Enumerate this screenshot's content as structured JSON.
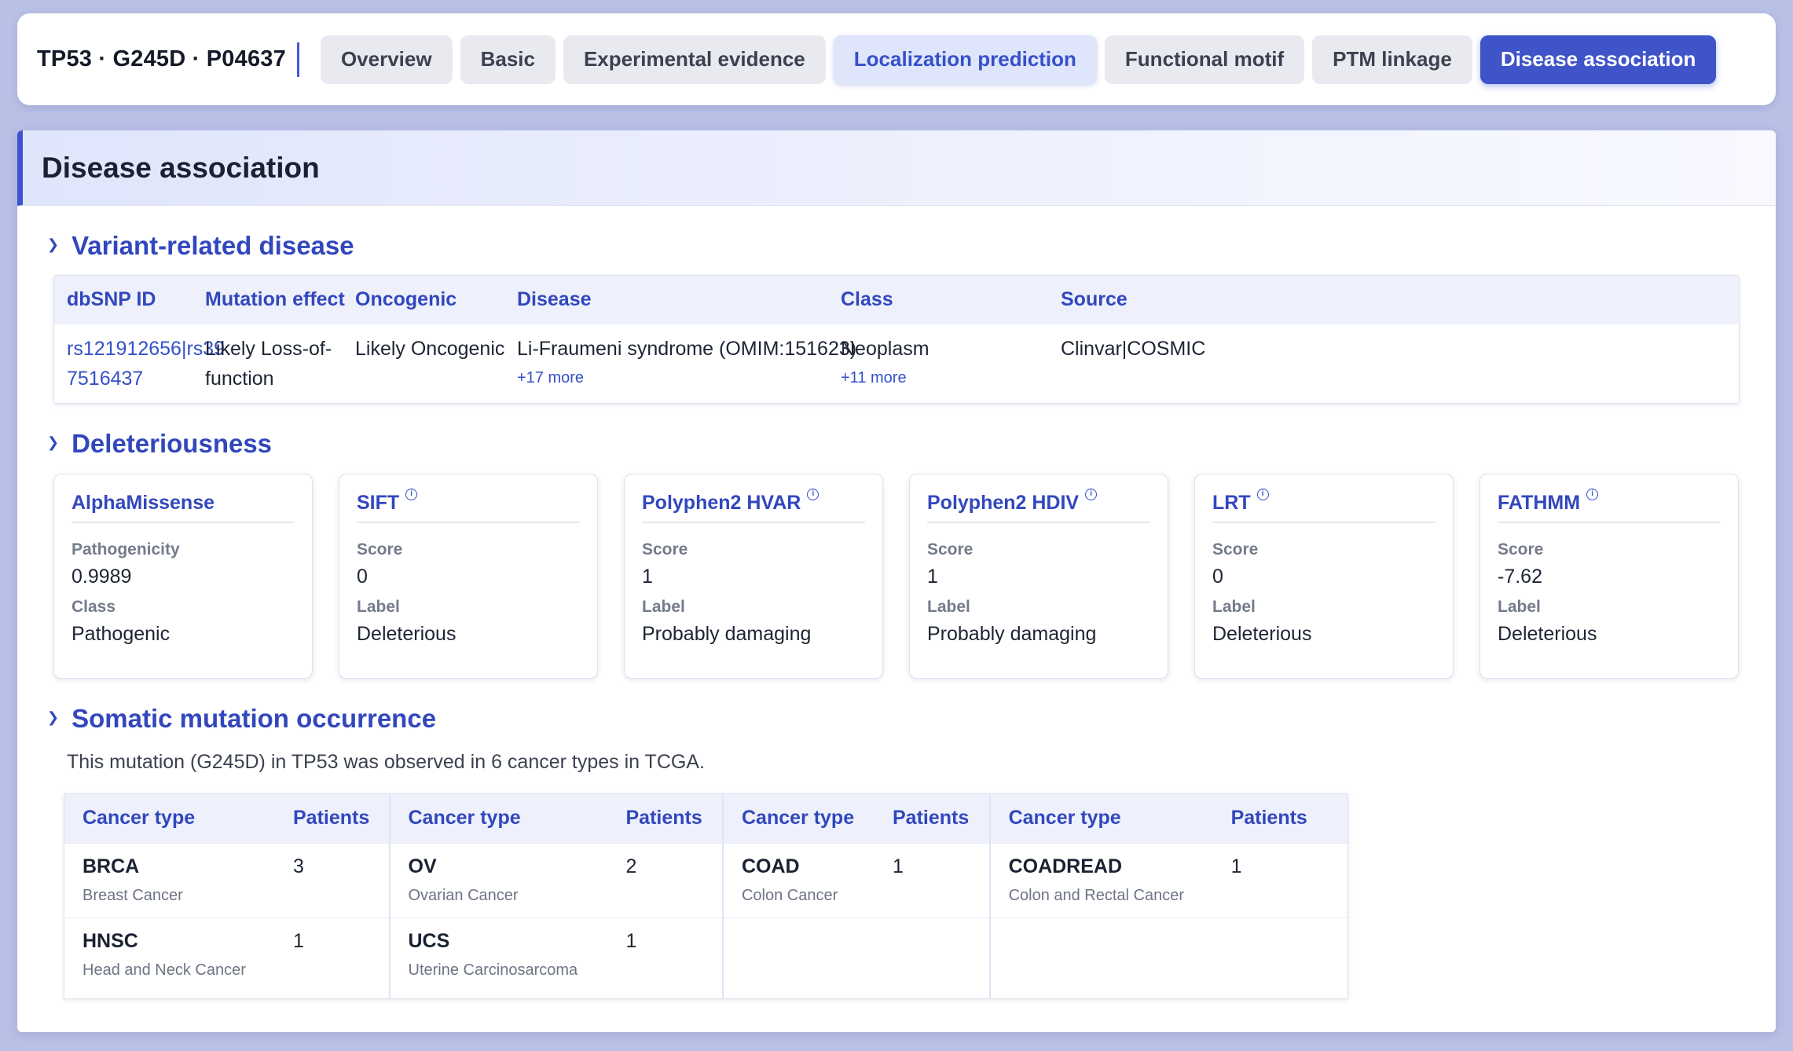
{
  "header": {
    "brand": "TP53 · G245D · P04637",
    "tabs": [
      {
        "label": "Overview",
        "state": "default"
      },
      {
        "label": "Basic",
        "state": "default"
      },
      {
        "label": "Experimental evidence",
        "state": "default"
      },
      {
        "label": "Localization prediction",
        "state": "hover"
      },
      {
        "label": "Functional motif",
        "state": "default"
      },
      {
        "label": "PTM linkage",
        "state": "default"
      },
      {
        "label": "Disease association",
        "state": "active"
      }
    ]
  },
  "panel": {
    "title": "Disease association"
  },
  "variant_section": {
    "title": "Variant-related disease",
    "headers": [
      "dbSNP ID",
      "Mutation effect",
      "Oncogenic",
      "Disease",
      "Class",
      "Source"
    ],
    "row": {
      "dbsnp_line1": "rs121912656|rs39",
      "dbsnp_line2": "7516437",
      "effect_line1": "Likely Loss-of-",
      "effect_line2": "function",
      "oncogenic": "Likely Oncogenic",
      "disease": "Li-Fraumeni syndrome (OMIM:151623)",
      "disease_more": "+17 more",
      "class": "Neoplasm",
      "class_more": "+11 more",
      "source": "Clinvar|COSMIC"
    }
  },
  "deleteriousness": {
    "title": "Deleteriousness",
    "cards": [
      {
        "title": "AlphaMissense",
        "info": false,
        "label1": "Pathogenicity",
        "value1": "0.9989",
        "label2": "Class",
        "value2": "Pathogenic"
      },
      {
        "title": "SIFT",
        "info": true,
        "label1": "Score",
        "value1": "0",
        "label2": "Label",
        "value2": "Deleterious"
      },
      {
        "title": "Polyphen2 HVAR",
        "info": true,
        "label1": "Score",
        "value1": "1",
        "label2": "Label",
        "value2": "Probably damaging"
      },
      {
        "title": "Polyphen2 HDIV",
        "info": true,
        "label1": "Score",
        "value1": "1",
        "label2": "Label",
        "value2": "Probably damaging"
      },
      {
        "title": "LRT",
        "info": true,
        "label1": "Score",
        "value1": "0",
        "label2": "Label",
        "value2": "Deleterious"
      },
      {
        "title": "FATHMM",
        "info": true,
        "label1": "Score",
        "value1": "-7.62",
        "label2": "Label",
        "value2": "Deleterious"
      }
    ]
  },
  "somatic": {
    "title": "Somatic mutation occurrence",
    "summary": "This mutation (G245D) in TP53 was observed in 6 cancer types in TCGA.",
    "header_type": "Cancer type",
    "header_patients": "Patients",
    "groups": [
      {
        "rows": [
          {
            "code": "BRCA",
            "name": "Breast Cancer",
            "patients": "3"
          },
          {
            "code": "HNSC",
            "name": "Head and Neck Cancer",
            "patients": "1"
          }
        ]
      },
      {
        "rows": [
          {
            "code": "OV",
            "name": "Ovarian Cancer",
            "patients": "2"
          },
          {
            "code": "UCS",
            "name": "Uterine Carcinosarcoma",
            "patients": "1"
          }
        ]
      },
      {
        "rows": [
          {
            "code": "COAD",
            "name": "Colon Cancer",
            "patients": "1"
          }
        ]
      },
      {
        "rows": [
          {
            "code": "COADREAD",
            "name": "Colon and Rectal Cancer",
            "patients": "1"
          }
        ]
      }
    ]
  }
}
